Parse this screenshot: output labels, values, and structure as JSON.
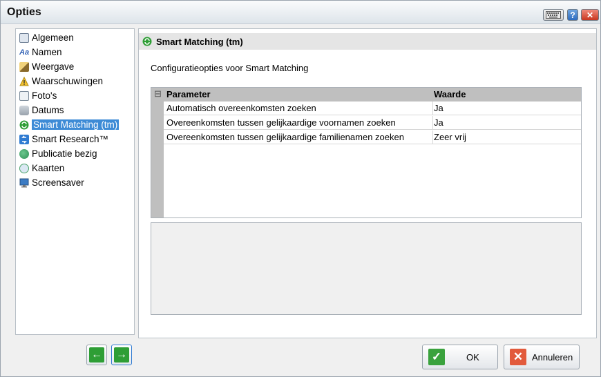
{
  "window": {
    "title": "Opties",
    "help_label": "?",
    "close_label": "✕",
    "keyboard_icon": "keyboard-icon"
  },
  "sidebar": {
    "items": [
      {
        "label": "Algemeen",
        "icon": "settings-page-icon",
        "color": "#6e7f95"
      },
      {
        "label": "Namen",
        "icon": "font-icon",
        "color": "#2e5fb4"
      },
      {
        "label": "Weergave",
        "icon": "brush-icon",
        "color": "#c8a03a"
      },
      {
        "label": "Waarschuwingen",
        "icon": "warning-icon",
        "color": "#f2c12e"
      },
      {
        "label": "Foto's",
        "icon": "photo-icon",
        "color": "#7a8a99"
      },
      {
        "label": "Datums",
        "icon": "calendar-icon",
        "color": "#9aa3ad"
      },
      {
        "label": "Smart Matching (tm)",
        "icon": "smart-matching-icon",
        "color": "#2e9e35"
      },
      {
        "label": "Smart Research™",
        "icon": "smart-research-icon",
        "color": "#2f7bd2"
      },
      {
        "label": "Publicatie bezig",
        "icon": "globe-icon",
        "color": "#2e8f55"
      },
      {
        "label": "Kaarten",
        "icon": "map-icon",
        "color": "#4aa36a"
      },
      {
        "label": "Screensaver",
        "icon": "monitor-icon",
        "color": "#3c7cc4"
      }
    ],
    "selected_index": 6
  },
  "panel": {
    "title": "Smart Matching (tm)",
    "description": "Configuratieopties voor Smart Matching",
    "grid": {
      "collapse_glyph": "⊟",
      "headers": [
        "Parameter",
        "Waarde"
      ],
      "rows": [
        {
          "parameter": "Automatisch overeenkomsten zoeken",
          "value": "Ja"
        },
        {
          "parameter": "Overeenkomsten tussen gelijkaardige voornamen zoeken",
          "value": "Ja"
        },
        {
          "parameter": "Overeenkomsten tussen gelijkaardige familienamen zoeken",
          "value": "Zeer vrij"
        }
      ]
    }
  },
  "footer": {
    "back_glyph": "←",
    "forward_glyph": "→",
    "ok_label": "OK",
    "ok_glyph": "✓",
    "cancel_label": "Annuleren",
    "cancel_glyph": "✕"
  }
}
